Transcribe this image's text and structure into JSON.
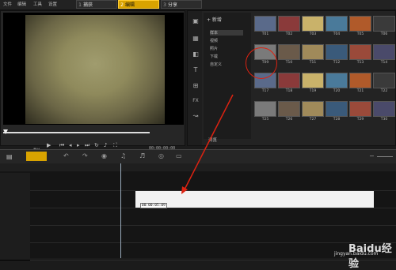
{
  "menu": [
    "文件",
    "编辑",
    "工具",
    "设置"
  ],
  "steps": [
    {
      "num": "1",
      "label": "捕获",
      "active": false
    },
    {
      "num": "2",
      "label": "编辑",
      "active": true
    },
    {
      "num": "3",
      "label": "分享",
      "active": false
    }
  ],
  "preview": {
    "mode_label": "素材",
    "timecode": "00:00:00:00"
  },
  "library": {
    "new_label": "+ 新增",
    "folders": [
      "样本",
      "视频",
      "照片",
      "下载",
      "自定义"
    ],
    "browse_label": "浏览",
    "thumbnails": [
      "T01",
      "T02",
      "T03",
      "T04",
      "T05",
      "T06",
      "T09",
      "T10",
      "T11",
      "T12",
      "T13",
      "T14",
      "T17",
      "T18",
      "T19",
      "T20",
      "T21",
      "T22",
      "T25",
      "T26",
      "T27",
      "T28",
      "T29",
      "T30"
    ]
  },
  "timeline": {
    "clip_timecode": "00:00:05:09"
  },
  "watermark": {
    "logo": "Baidu经验",
    "url": "jingyan.baidu.com"
  },
  "colors": {
    "active_step": "#d9a300",
    "highlight_ring": "#dd2211"
  }
}
